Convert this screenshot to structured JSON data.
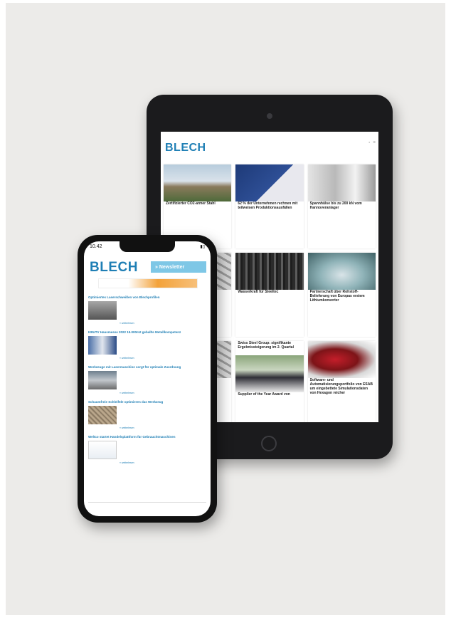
{
  "tablet": {
    "logo": "BLECH",
    "cards": [
      {
        "title": "Zertifizierter CO2-armer Stahl"
      },
      {
        "title": "62 % der Unternehmen rechnen mit teilweisen Produktionsausfällen"
      },
      {
        "title": "Spannhülse bis zu 200 kN vom Hannoveranlager"
      },
      {
        "title": "Wasserkraft für Steeltec"
      },
      {
        "title": "Partnerschaft über Rohstoff-Belieferung von Europas erstem Lithiumkonverter"
      },
      {
        "title": "Swiss Steel Group: signifikante Ergebnissteigerung im 2. Quartal"
      },
      {
        "title": "Supplier of the Year Award von"
      },
      {
        "title": "Software- und Automatisierungsportfolio von ESAB um eingebettete Simulationsdaten von Hexagon reicher"
      }
    ]
  },
  "phone": {
    "time": "10.42",
    "logo": "BLECH",
    "newsletter": "» Newsletter",
    "items": [
      {
        "heading": "Optimiertes Laserschweißen von Blechprofilen"
      },
      {
        "heading": "KBUTV Hausmesse 2022 15.000m2 geballte Metallkompetenz"
      },
      {
        "heading": "Werkzeuge mit Lasermaschine sorgt für optimale Zuordnung"
      },
      {
        "heading": "Schaumfreie Schleiföle optimieren das Werkzeug"
      },
      {
        "heading": "Weltco startet Handelsplattform für Gebrauchtmaschinen"
      }
    ],
    "more_label": "» weiterlesen"
  }
}
